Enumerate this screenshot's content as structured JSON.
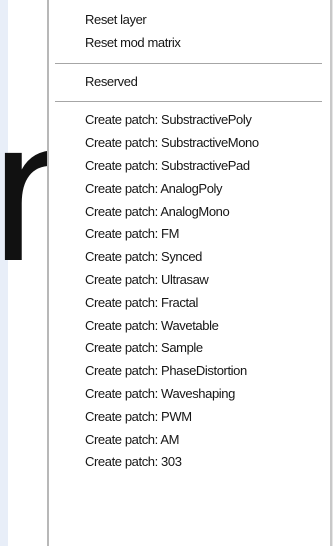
{
  "background": {
    "glyph": "r"
  },
  "menu": {
    "group1": [
      "Reset layer",
      "Reset mod matrix"
    ],
    "group2": [
      "Reserved"
    ],
    "group3": [
      "Create patch: SubstractivePoly",
      "Create patch: SubstractiveMono",
      "Create patch: SubstractivePad",
      "Create patch: AnalogPoly",
      "Create patch: AnalogMono",
      "Create patch: FM",
      "Create patch: Synced",
      "Create patch: Ultrasaw",
      "Create patch: Fractal",
      "Create patch: Wavetable",
      "Create patch: Sample",
      "Create patch: PhaseDistortion",
      "Create patch: Waveshaping",
      "Create patch: PWM",
      "Create patch: AM",
      "Create patch: 303"
    ]
  }
}
